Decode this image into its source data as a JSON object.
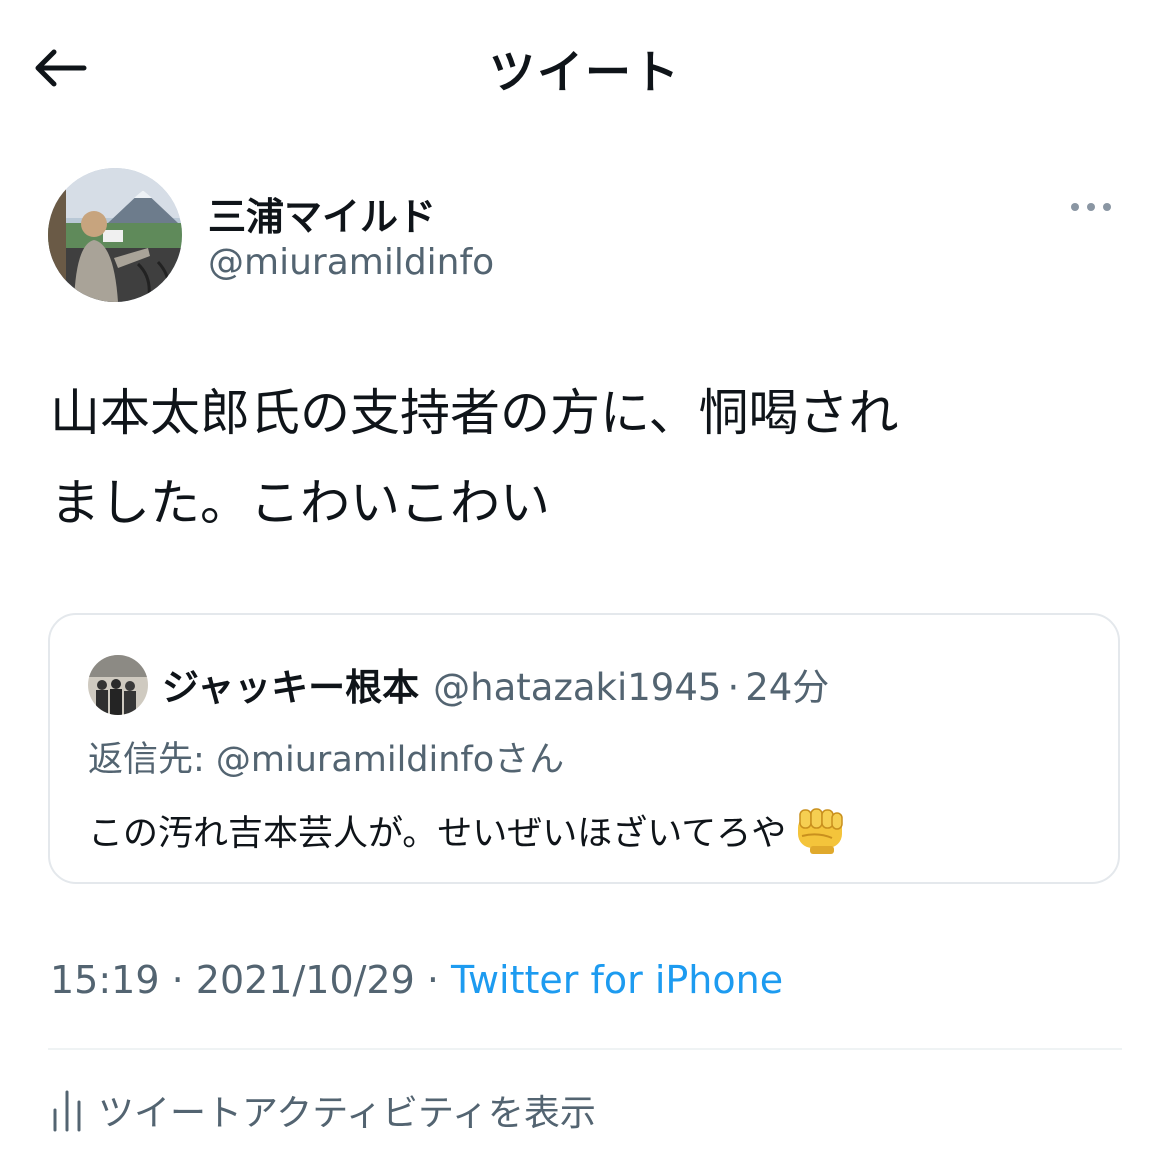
{
  "header": {
    "title": "ツイート",
    "back_icon": "arrow-left-icon"
  },
  "author": {
    "name": "三浦マイルド",
    "handle": "@miuramildinfo",
    "more_icon": "more-horizontal-icon"
  },
  "tweet": {
    "line1": "山本太郎氏の支持者の方に、恫喝され",
    "line2": "ました。こわいこわい"
  },
  "quote": {
    "name": "ジャッキー根本",
    "handle": "@hatazaki1945",
    "separator": "·",
    "time": "24分",
    "reply_prefix": "返信先: ",
    "reply_mention": "@miuramildinfo",
    "reply_suffix": "さん",
    "text": "この汚れ吉本芸人が。せいぜいほざいてろや",
    "emoji_icon": "oncoming-fist-icon"
  },
  "meta": {
    "time": "15:19",
    "sep1": " · ",
    "date": "2021/10/29",
    "sep2": " · ",
    "source": "Twitter for iPhone"
  },
  "activity": {
    "label": "ツイートアクティビティを表示",
    "icon": "analytics-icon"
  },
  "colors": {
    "text": "#0f1419",
    "secondary": "#536471",
    "accent": "#1d9bf0",
    "border": "#e4e8ec"
  }
}
